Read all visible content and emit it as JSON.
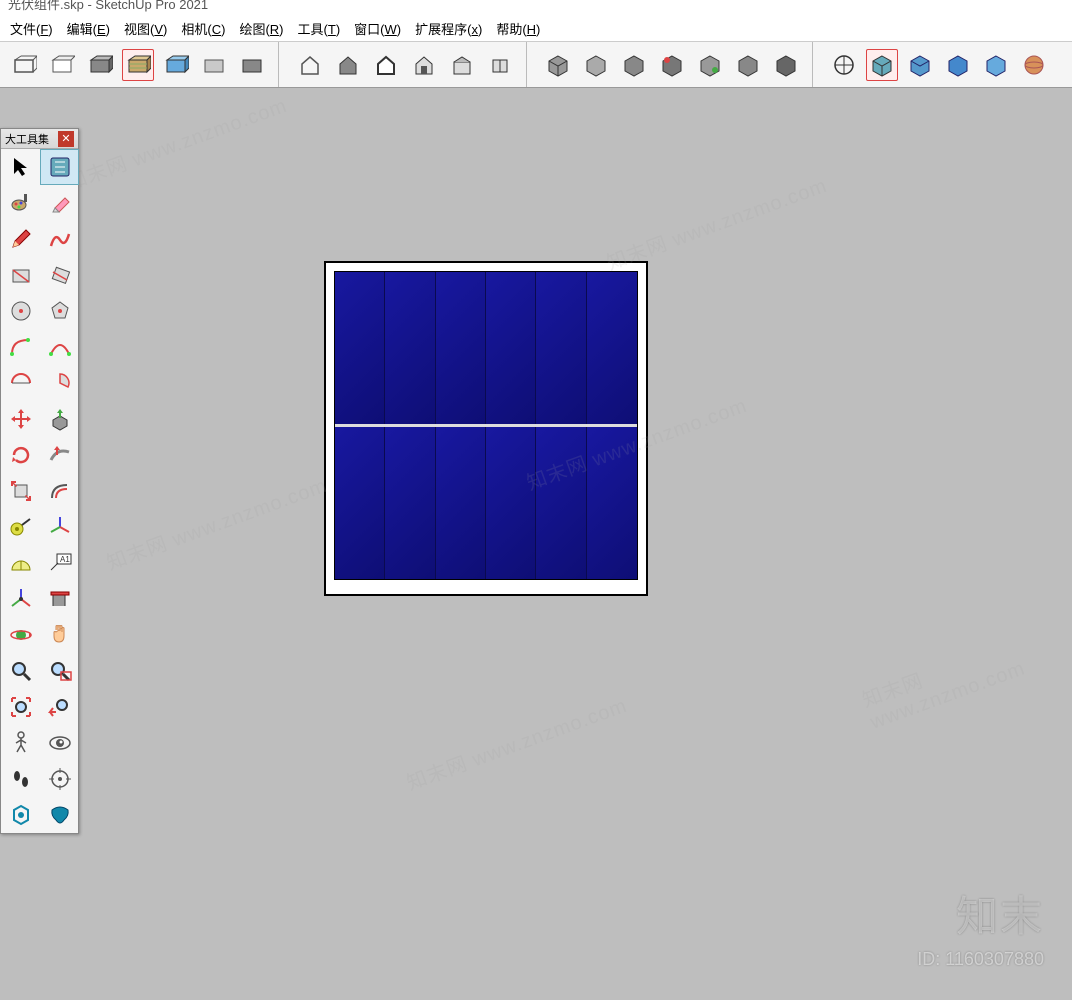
{
  "title": "光伏组件.skp - SketchUp Pro 2021",
  "menu": [
    {
      "label": "文件",
      "key": "F"
    },
    {
      "label": "编辑",
      "key": "E"
    },
    {
      "label": "视图",
      "key": "V"
    },
    {
      "label": "相机",
      "key": "C"
    },
    {
      "label": "绘图",
      "key": "R"
    },
    {
      "label": "工具",
      "key": "T"
    },
    {
      "label": "窗口",
      "key": "W"
    },
    {
      "label": "扩展程序",
      "key": "x"
    },
    {
      "label": "帮助",
      "key": "H"
    }
  ],
  "toolbar_groups": [
    [
      "box-wire",
      "box-hidden",
      "box-shaded",
      "box-shaded-tex",
      "box-mono",
      "box-xray",
      "box-color"
    ],
    [
      "house-open",
      "house-solid",
      "house-outline",
      "house-front",
      "house-side",
      "house-top"
    ],
    [
      "cube-a",
      "cube-b",
      "cube-c",
      "cube-d",
      "cube-e",
      "cube-f",
      "cube-g"
    ],
    [
      "circle-cross",
      "cube-blue-a",
      "cube-blue-b",
      "cube-blue-c",
      "cube-blue-d",
      "sphere"
    ]
  ],
  "palette": {
    "title": "大工具集",
    "close": "✕",
    "tools": [
      "select",
      "select-all",
      "paint",
      "eraser",
      "pencil",
      "freehand",
      "rect",
      "rot-rect",
      "circle",
      "polygon",
      "arc",
      "arc2",
      "arc3",
      "pie",
      "move",
      "pushpull",
      "rotate",
      "followme",
      "scale",
      "offset",
      "tape",
      "axes",
      "protractor",
      "text",
      "axes3d",
      "section",
      "orbit",
      "pan",
      "zoom",
      "zoom-window",
      "zoom-extents",
      "prev-view",
      "walk",
      "lookaround",
      "footprints",
      "target",
      "ext-a",
      "ext-b"
    ]
  },
  "watermark": {
    "brand": "知末",
    "diag": "知末网 www.znzmo.com",
    "id_label": "ID: ",
    "id": "1160307880"
  }
}
